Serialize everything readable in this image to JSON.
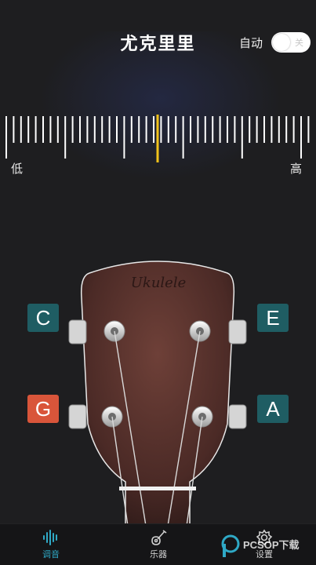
{
  "header": {
    "title": "尤克里里",
    "auto_label": "自动",
    "auto_toggle_state": "关"
  },
  "tuner": {
    "low_label": "低",
    "high_label": "高",
    "needle_color": "#f2c21b"
  },
  "headstock": {
    "brand": "Ukulele"
  },
  "strings": [
    {
      "note": "C",
      "color": "#1f5d63"
    },
    {
      "note": "E",
      "color": "#1f5d63"
    },
    {
      "note": "G",
      "color": "#d9553a",
      "active": true
    },
    {
      "note": "A",
      "color": "#1f5d63"
    }
  ],
  "tabbar": {
    "items": [
      {
        "label": "调音",
        "icon": "waveform-icon",
        "active": true,
        "color": "#2fa9c6"
      },
      {
        "label": "乐器",
        "icon": "guitar-icon",
        "active": false,
        "color": "#cfcfcf"
      },
      {
        "label": "设置",
        "icon": "gear-icon",
        "active": false,
        "color": "#cfcfcf"
      }
    ]
  },
  "watermark": {
    "text": "PCSOP下载"
  }
}
